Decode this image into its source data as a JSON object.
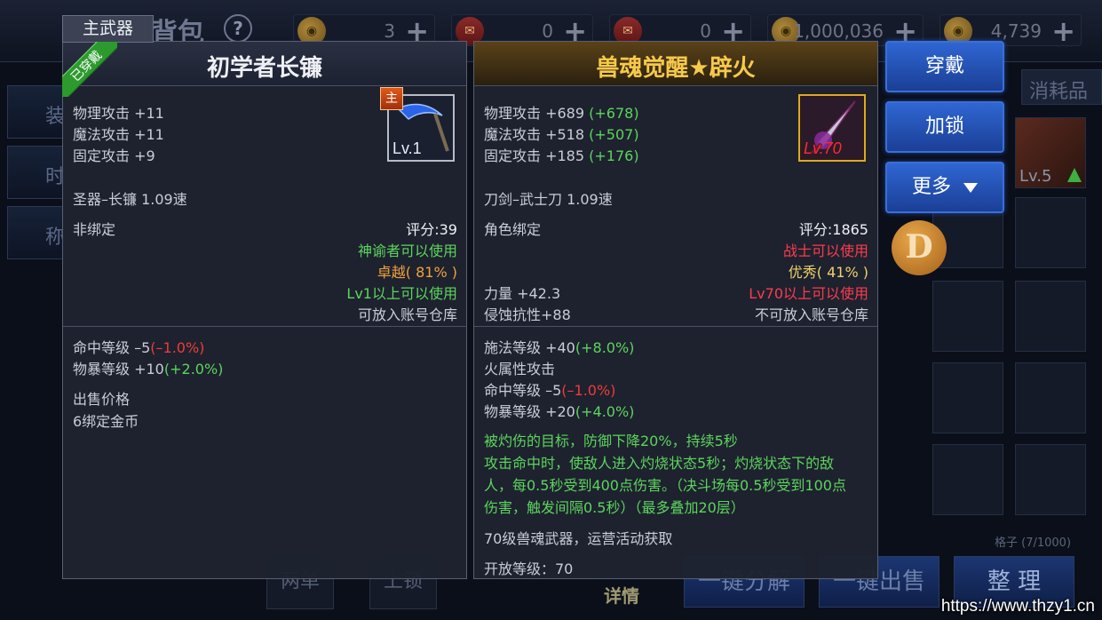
{
  "header": {
    "title": "背包",
    "currencies": [
      {
        "icon": "gold-coin-icon",
        "value": "3"
      },
      {
        "icon": "scroll-icon",
        "value": "0"
      },
      {
        "icon": "scroll-icon",
        "value": "0"
      },
      {
        "icon": "gold-coin-icon",
        "value": "1,000,036"
      },
      {
        "icon": "gold-coin-icon",
        "value": "4,739"
      }
    ]
  },
  "background": {
    "left_tabs": [
      "装",
      "时",
      "称"
    ],
    "consumables_tab": "消耗品",
    "boot_slot_level": "Lv.5",
    "d_badge": "D",
    "capacity": "格子 (7/1000)",
    "bottom": {
      "btn_a": "两单",
      "btn_b": "上锁",
      "detail": "详情",
      "decompose": "一键分解",
      "sell": "一键出售",
      "sort": "整 理"
    }
  },
  "left_panel": {
    "tab": "主武器",
    "equipped": "已穿戴",
    "title": "初学者长镰",
    "main_badge": "主",
    "icon_level": "Lv.1",
    "stats": [
      "物理攻击 +11",
      "魔法攻击 +11",
      "固定攻击 +9"
    ],
    "type_speed": "圣器–长镰 1.09速",
    "binding": "非绑定",
    "score": "评分:39",
    "usable_by": "神谕者可以使用",
    "quality": "卓越( 81% )",
    "level_req": "Lv1以上可以使用",
    "storage": "可放入账号仓库",
    "extra_stats": [
      {
        "text": "命中等级 –5",
        "paren": "(–1.0%)",
        "color": "red"
      },
      {
        "text": "物暴等级 +10",
        "paren": "(+2.0%)",
        "color": "green"
      }
    ],
    "sell_label": "出售价格",
    "sell_value": "6绑定金币"
  },
  "right_panel": {
    "title": "兽魂觉醒★辟火",
    "icon_level": "Lv.70",
    "stats": [
      {
        "text": "物理攻击 +689",
        "delta": "(+678)"
      },
      {
        "text": "魔法攻击 +518",
        "delta": "(+507)"
      },
      {
        "text": "固定攻击 +185",
        "delta": "(+176)"
      }
    ],
    "type_speed": "刀剑–武士刀 1.09速",
    "binding": "角色绑定",
    "score": "评分:1865",
    "usable_by": "战士可以使用",
    "quality": "优秀( 41% )",
    "strength": "力量 +42.3",
    "corrosion": "侵蚀抗性+88",
    "level_req": "Lv70以上可以使用",
    "storage": "不可放入账号仓库",
    "extra_stats": [
      {
        "text": "施法等级 +40",
        "paren": "(+8.0%)",
        "color": "green"
      },
      {
        "text": "火属性攻击",
        "paren": "",
        "color": ""
      },
      {
        "text": "命中等级 –5",
        "paren": "(–1.0%)",
        "color": "red"
      },
      {
        "text": "物暴等级 +20",
        "paren": "(+4.0%)",
        "color": "green"
      }
    ],
    "effect_lines": [
      "被灼伤的目标，防御下降20%，持续5秒",
      "攻击命中时，使敌人进入灼烧状态5秒；灼烧状态下的敌",
      "人，每0.5秒受到400点伤害。（决斗场每0.5秒受到100点",
      "伤害，触发间隔0.5秒）（最多叠加20层）"
    ],
    "source": "70级兽魂武器，运营活动获取",
    "open_level": "开放等级：70"
  },
  "actions": {
    "wear": "穿戴",
    "lock": "加锁",
    "more": "更多"
  },
  "watermark": "https://www.thzy1.cn"
}
